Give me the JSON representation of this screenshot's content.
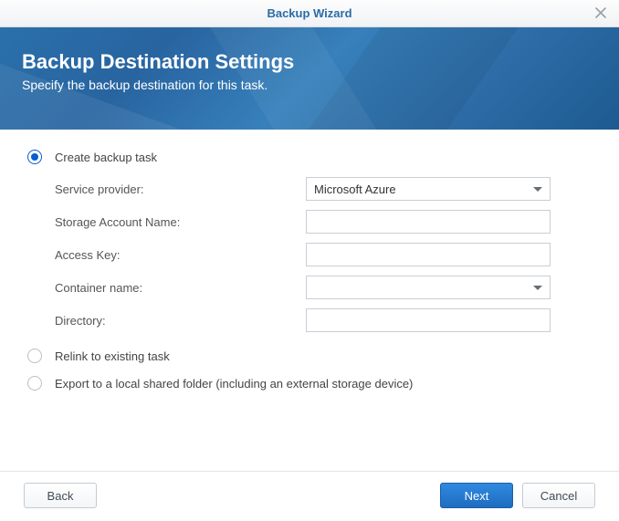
{
  "window": {
    "title": "Backup Wizard"
  },
  "header": {
    "title": "Backup Destination Settings",
    "subtitle": "Specify the backup destination for this task."
  },
  "options": {
    "create": "Create backup task",
    "relink": "Relink to existing task",
    "export": "Export to a local shared folder (including an external storage device)"
  },
  "fields": {
    "service_provider": {
      "label": "Service provider:",
      "value": "Microsoft Azure"
    },
    "storage_account": {
      "label": "Storage Account Name:",
      "value": ""
    },
    "access_key": {
      "label": "Access Key:",
      "value": ""
    },
    "container": {
      "label": "Container name:",
      "value": ""
    },
    "directory": {
      "label": "Directory:",
      "value": ""
    }
  },
  "buttons": {
    "back": "Back",
    "next": "Next",
    "cancel": "Cancel"
  }
}
